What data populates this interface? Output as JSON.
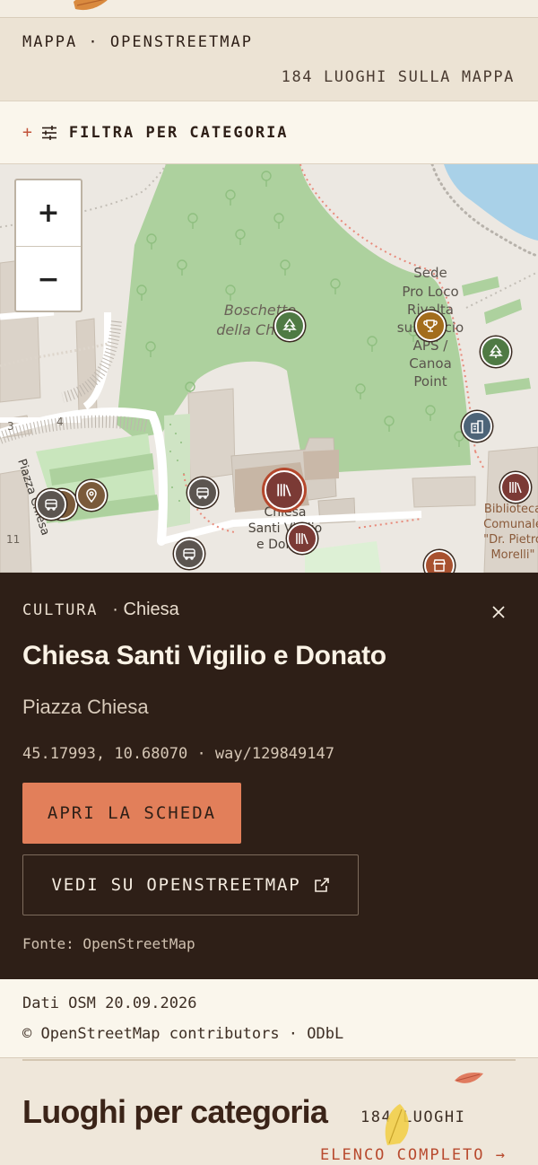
{
  "header": {
    "title": "MAPPA · OPENSTREETMAP",
    "count": "184 LUOGHI SULLA MAPPA"
  },
  "filter": {
    "plus": "+",
    "label": "FILTRA PER CATEGORIA"
  },
  "map": {
    "zoom_in": "+",
    "zoom_out": "−",
    "labels": {
      "park": [
        "Boschetto",
        "della Chiesa"
      ],
      "proloco": [
        "Sede",
        "Pro Loco",
        "Rivalta",
        "sul Mincio",
        "APS /",
        "Canoa",
        "Point"
      ],
      "church": [
        "Chiesa",
        "Santi Vigilio",
        "e Donato"
      ],
      "library": [
        "Biblioteca",
        "Comunale",
        "\"Dr. Pietro",
        "Morelli\""
      ],
      "street": "Piazza Chiesa",
      "numbers": [
        "3",
        "4",
        "11"
      ]
    }
  },
  "detail": {
    "category": "CULTURA",
    "subcategory": "· Chiesa",
    "title": "Chiesa Santi Vigilio e Donato",
    "address": "Piazza Chiesa",
    "coords": "45.17993, 10.68070 · way/129849147",
    "open_button": "APRI LA SCHEDA",
    "osm_button": "VEDI SU OPENSTREETMAP",
    "source": "Fonte: OpenStreetMap"
  },
  "attribution": {
    "date": "Dati OSM 20.09.2026",
    "copyright": "© OpenStreetMap contributors · ODbL"
  },
  "section": {
    "title": "Luoghi per categoria",
    "count": "184 LUOGHI",
    "link": "ELENCO COMPLETO →"
  },
  "colors": {
    "panel_bg": "#2e1f17",
    "accent": "#e27f5a",
    "link": "#b84a2e",
    "marker_green": "#4f7a44",
    "marker_amber": "#a36d1c",
    "marker_slate": "#4d6478",
    "marker_wine": "#7b3a35",
    "marker_grey": "#5c5550",
    "marker_brown": "#7a5a3a"
  },
  "icons": [
    "leaf-icon",
    "sliders-icon",
    "tree-icon",
    "trophy-icon",
    "building-icon",
    "library-icon",
    "bus-icon",
    "pin-icon",
    "shop-icon",
    "close-icon",
    "external-link-icon"
  ]
}
